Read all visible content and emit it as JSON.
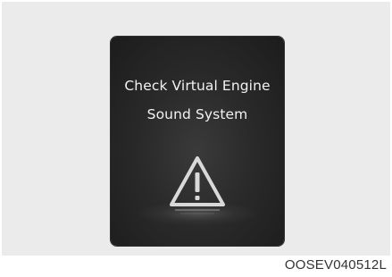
{
  "display": {
    "message_line1": "Check Virtual Engine",
    "message_line2": "Sound System",
    "warning_icon": "warning-triangle-icon",
    "background_color": "#2a2a2a",
    "text_color": "#f2f2f2"
  },
  "figure": {
    "code": "OOSEV040512L"
  }
}
